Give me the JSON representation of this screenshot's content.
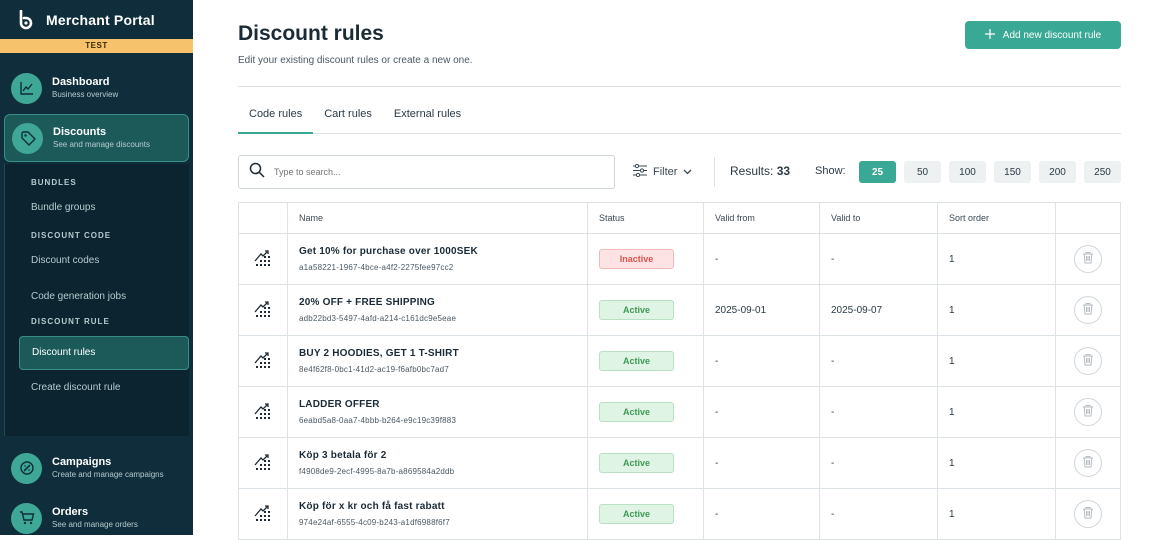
{
  "sidebar": {
    "brand": "Merchant Portal",
    "env": "TEST",
    "items": [
      {
        "title": "Dashboard",
        "subtitle": "Business overview"
      },
      {
        "title": "Discounts",
        "subtitle": "See and manage discounts"
      },
      {
        "title": "Campaigns",
        "subtitle": "Create and manage campaigns"
      },
      {
        "title": "Orders",
        "subtitle": "See and manage orders"
      }
    ],
    "sub": {
      "bundles_head": "BUNDLES",
      "bundle_groups": "Bundle groups",
      "code_head": "DISCOUNT CODE",
      "discount_codes": "Discount codes",
      "code_jobs": "Code generation jobs",
      "rule_head": "DISCOUNT RULE",
      "discount_rules": "Discount rules",
      "create_rule": "Create discount rule"
    }
  },
  "header": {
    "title": "Discount rules",
    "subtitle": "Edit your existing discount rules or create a new one.",
    "add_button": "Add new discount rule"
  },
  "tabs": [
    "Code rules",
    "Cart rules",
    "External rules"
  ],
  "toolbar": {
    "search_placeholder": "Type to search...",
    "filter_label": "Filter",
    "results_label": "Results:",
    "results_count": "33",
    "show_label": "Show:",
    "page_sizes": [
      "25",
      "50",
      "100",
      "150",
      "200",
      "250"
    ],
    "selected_page_size": "25"
  },
  "table": {
    "headers": [
      "Name",
      "Status",
      "Valid from",
      "Valid to",
      "Sort order"
    ],
    "rows": [
      {
        "name": "Get 10% for purchase over 1000SEK",
        "id": "a1a58221-1967-4bce-a4f2-2275fee97cc2",
        "status": "Inactive",
        "valid_from": "-",
        "valid_to": "-",
        "sort_order": "1"
      },
      {
        "name": "20% OFF + FREE SHIPPING",
        "id": "adb22bd3-5497-4afd-a214-c161dc9e5eae",
        "status": "Active",
        "valid_from": "2025-09-01",
        "valid_to": "2025-09-07",
        "sort_order": "1"
      },
      {
        "name": "BUY 2 HOODIES, GET 1 T-SHIRT",
        "id": "8e4f62f8-0bc1-41d2-ac19-f6afb0bc7ad7",
        "status": "Active",
        "valid_from": "-",
        "valid_to": "-",
        "sort_order": "1"
      },
      {
        "name": "LADDER OFFER",
        "id": "6eabd5a8-0aa7-4bbb-b264-e9c19c39f883",
        "status": "Active",
        "valid_from": "-",
        "valid_to": "-",
        "sort_order": "1"
      },
      {
        "name": "Köp 3 betala för 2",
        "id": "f4908de9-2ecf-4995-8a7b-a869584a2ddb",
        "status": "Active",
        "valid_from": "-",
        "valid_to": "-",
        "sort_order": "1"
      },
      {
        "name": "Köp för x kr och få fast rabatt",
        "id": "974e24af-6555-4c09-b243-a1df6988f6f7",
        "status": "Active",
        "valid_from": "-",
        "valid_to": "-",
        "sort_order": "1"
      }
    ]
  },
  "colors": {
    "accent": "#39a894",
    "sidebar": "#0f2d3a",
    "inactive": "#d9534f",
    "active": "#3e9a56"
  }
}
